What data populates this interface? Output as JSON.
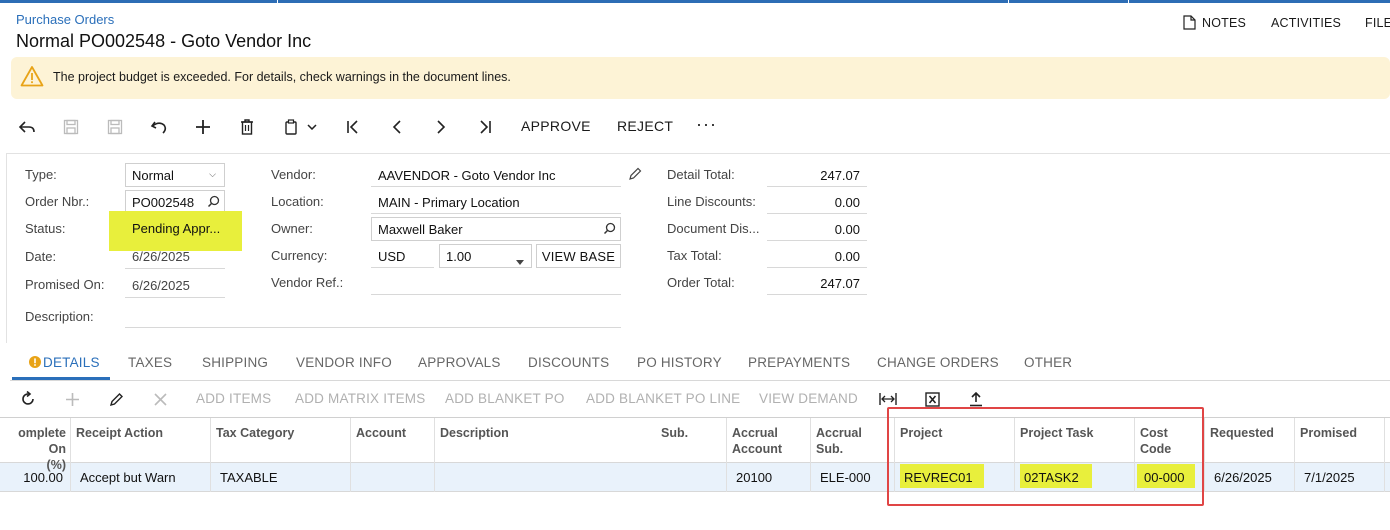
{
  "breadcrumb": "Purchase Orders",
  "title": "Normal PO002548 - Goto Vendor Inc",
  "header_links": {
    "notes": "NOTES",
    "activities": "ACTIVITIES",
    "files": "FILE"
  },
  "warning": "The project budget is exceeded. For details, check warnings in the document lines.",
  "toolbar": {
    "approve": "APPROVE",
    "reject": "REJECT",
    "more": "···"
  },
  "form": {
    "type_label": "Type:",
    "type_value": "Normal",
    "order_label": "Order Nbr.:",
    "order_value": "PO002548",
    "status_label": "Status:",
    "status_value": "Pending Appr...",
    "date_label": "Date:",
    "date_value": "6/26/2025",
    "promised_label": "Promised On:",
    "promised_value": "6/26/2025",
    "description_label": "Description:",
    "vendor_label": "Vendor:",
    "vendor_value": "AAVENDOR - Goto Vendor Inc",
    "location_label": "Location:",
    "location_value": "MAIN - Primary Location",
    "owner_label": "Owner:",
    "owner_value": "Maxwell Baker",
    "currency_label": "Currency:",
    "currency_value": "USD",
    "rate_value": "1.00",
    "view_base": "VIEW BASE",
    "vendor_ref_label": "Vendor Ref.:",
    "detail_total_label": "Detail Total:",
    "detail_total": "247.07",
    "line_disc_label": "Line Discounts:",
    "line_disc": "0.00",
    "doc_disc_label": "Document Dis...",
    "doc_disc": "0.00",
    "tax_total_label": "Tax Total:",
    "tax_total": "0.00",
    "order_total_label": "Order Total:",
    "order_total": "247.07"
  },
  "tabs": [
    "DETAILS",
    "TAXES",
    "SHIPPING",
    "VENDOR INFO",
    "APPROVALS",
    "DISCOUNTS",
    "PO HISTORY",
    "PREPAYMENTS",
    "CHANGE ORDERS",
    "OTHER"
  ],
  "grid_toolbar": [
    "ADD ITEMS",
    "ADD MATRIX ITEMS",
    "ADD BLANKET PO",
    "ADD BLANKET PO LINE",
    "VIEW DEMAND"
  ],
  "columns": {
    "complete_on_1": "omplete On",
    "complete_on_2": "(%)",
    "receipt_action": "Receipt Action",
    "tax_category": "Tax Category",
    "account": "Account",
    "description": "Description",
    "sub": "Sub.",
    "accrual_account_1": "Accrual",
    "accrual_account_2": "Account",
    "accrual_sub_1": "Accrual",
    "accrual_sub_2": "Sub.",
    "project": "Project",
    "project_task": "Project Task",
    "cost_code_1": "Cost",
    "cost_code_2": "Code",
    "requested": "Requested",
    "promised": "Promised"
  },
  "row": {
    "complete_on": "100.00",
    "receipt_action": "Accept but Warn",
    "tax_category": "TAXABLE",
    "accrual_account": "20100",
    "accrual_sub": "ELE-000",
    "project": "REVREC01",
    "project_task": "02TASK2",
    "cost_code": "00-000",
    "requested": "6/26/2025",
    "promised": "7/1/2025"
  },
  "colors": {
    "accent": "#2a6fba",
    "warning_bg": "#fdf3d6",
    "highlight": "#e8ef3c",
    "annotation": "#e04545"
  }
}
